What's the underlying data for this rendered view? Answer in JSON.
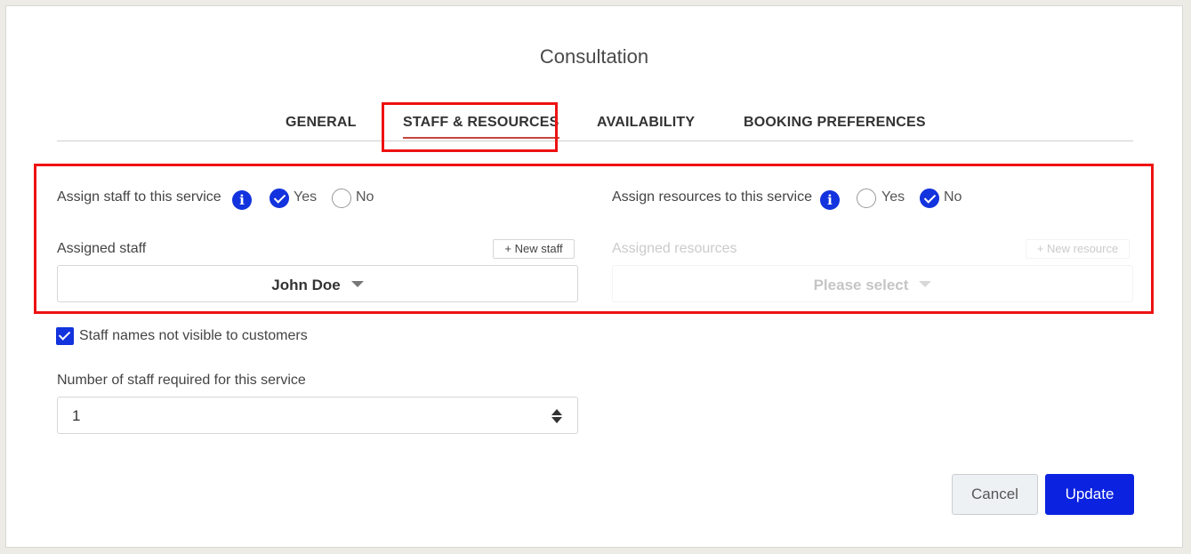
{
  "modal": {
    "title": "Consultation"
  },
  "tabs": [
    {
      "label": "GENERAL"
    },
    {
      "label": "STAFF & RESOURCES"
    },
    {
      "label": "AVAILABILITY"
    },
    {
      "label": "BOOKING PREFERENCES"
    }
  ],
  "staff": {
    "assign_label": "Assign staff to this service",
    "yes_label": "Yes",
    "no_label": "No",
    "assigned_label": "Assigned staff",
    "new_button": "+ New staff",
    "selected": "John Doe",
    "assign_value": "Yes",
    "names_hidden_label": "Staff names not visible to customers",
    "names_hidden_checked": true,
    "required_label": "Number of staff required for this service",
    "required_value": "1"
  },
  "resources": {
    "assign_label": "Assign resources to this service",
    "yes_label": "Yes",
    "no_label": "No",
    "assigned_label": "Assigned resources",
    "new_button": "+ New resource",
    "placeholder": "Please select",
    "assign_value": "No"
  },
  "footer": {
    "cancel_label": "Cancel",
    "update_label": "Update"
  },
  "colors": {
    "accent": "#1233dd",
    "tab_underline": "#c8463b",
    "highlight": "#ee1111"
  }
}
